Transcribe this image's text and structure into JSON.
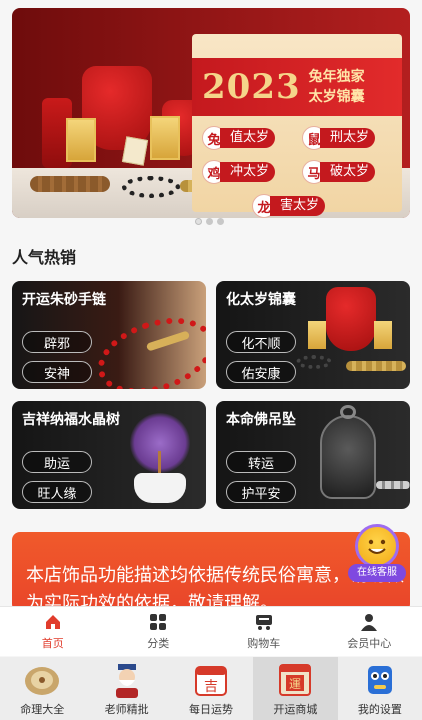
{
  "banner": {
    "year": "2023",
    "subtitle_line1": "兔年独家",
    "subtitle_line2": "太岁锦囊",
    "items": [
      {
        "badge": "兔",
        "text": "值太岁"
      },
      {
        "badge": "鼠",
        "text": "刑太岁"
      },
      {
        "badge": "鸡",
        "text": "冲太岁"
      },
      {
        "badge": "马",
        "text": "破太岁"
      },
      {
        "badge": "龙",
        "text": "害太岁"
      }
    ]
  },
  "section": {
    "title": "人气热销"
  },
  "products": [
    {
      "title": "开运朱砂手链",
      "tags": [
        "辟邪",
        "安神"
      ]
    },
    {
      "title": "化太岁锦囊",
      "tags": [
        "化不顺",
        "佑安康"
      ]
    },
    {
      "title": "吉祥纳福水晶树",
      "tags": [
        "助运",
        "旺人缘"
      ]
    },
    {
      "title": "本命佛吊坠",
      "tags": [
        "转运",
        "护平安"
      ]
    }
  ],
  "notice": {
    "text": "本店饰品功能描述均依据传统民俗寓意，请勿做为实际功效的依据，敬请理解。"
  },
  "support": {
    "label": "在线客服"
  },
  "shop_nav": [
    {
      "label": "首页",
      "icon": "home-icon",
      "active": true
    },
    {
      "label": "分类",
      "icon": "grid-icon",
      "active": false
    },
    {
      "label": "购物车",
      "icon": "cart-icon",
      "active": false
    },
    {
      "label": "会员中心",
      "icon": "user-icon",
      "active": false
    }
  ],
  "app_nav": [
    {
      "label": "命理大全",
      "icon": "compass-icon"
    },
    {
      "label": "老师精批",
      "icon": "master-icon"
    },
    {
      "label": "每日运势",
      "icon": "calendar-icon",
      "glyph": "吉"
    },
    {
      "label": "开运商城",
      "icon": "shop-icon",
      "glyph": "運",
      "active": true
    },
    {
      "label": "我的设置",
      "icon": "robot-icon"
    }
  ],
  "colors": {
    "accent": "#e13c2c",
    "banner_red": "#c4191e",
    "gold": "#f5d58a"
  }
}
